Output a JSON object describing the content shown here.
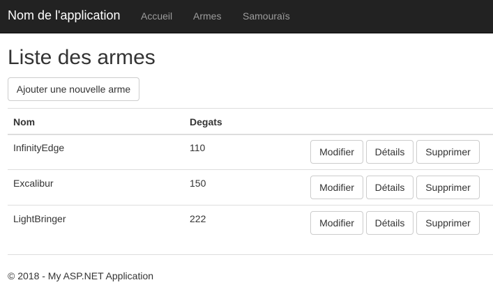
{
  "navbar": {
    "brand": "Nom de l'application",
    "links": [
      "Accueil",
      "Armes",
      "Samouraïs"
    ]
  },
  "page": {
    "title": "Liste des armes",
    "add_button": "Ajouter une nouvelle arme"
  },
  "table": {
    "headers": [
      "Nom",
      "Degats"
    ],
    "rows": [
      {
        "name": "InfinityEdge",
        "degats": "110"
      },
      {
        "name": "Excalibur",
        "degats": "150"
      },
      {
        "name": "LightBringer",
        "degats": "222"
      }
    ],
    "actions": {
      "edit": "Modifier",
      "details": "Détails",
      "delete": "Supprimer"
    }
  },
  "footer": {
    "text": "© 2018 - My ASP.NET Application"
  }
}
